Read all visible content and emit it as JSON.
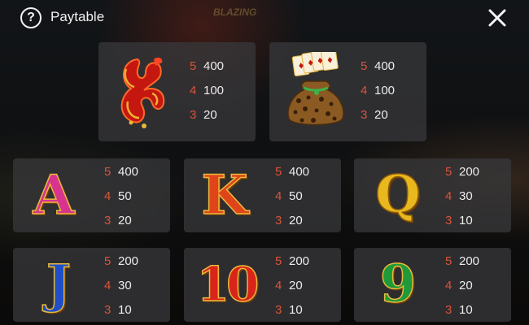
{
  "header": {
    "title": "Paytable",
    "help_icon": "question-circle-icon",
    "close_icon": "close-x-icon",
    "background_logo": "BLAZING"
  },
  "symbols": [
    {
      "name": "red-ribbon-knot",
      "icon": "red-knot-icon",
      "pays": [
        {
          "count": "5",
          "amount": "400"
        },
        {
          "count": "4",
          "amount": "100"
        },
        {
          "count": "3",
          "amount": "20"
        }
      ]
    },
    {
      "name": "money-bag",
      "icon": "money-bag-icon",
      "pays": [
        {
          "count": "5",
          "amount": "400"
        },
        {
          "count": "4",
          "amount": "100"
        },
        {
          "count": "3",
          "amount": "20"
        }
      ]
    },
    {
      "name": "A",
      "glyph": "A",
      "pays": [
        {
          "count": "5",
          "amount": "400"
        },
        {
          "count": "4",
          "amount": "50"
        },
        {
          "count": "3",
          "amount": "20"
        }
      ]
    },
    {
      "name": "K",
      "glyph": "K",
      "pays": [
        {
          "count": "5",
          "amount": "400"
        },
        {
          "count": "4",
          "amount": "50"
        },
        {
          "count": "3",
          "amount": "20"
        }
      ]
    },
    {
      "name": "Q",
      "glyph": "Q",
      "pays": [
        {
          "count": "5",
          "amount": "200"
        },
        {
          "count": "4",
          "amount": "30"
        },
        {
          "count": "3",
          "amount": "10"
        }
      ]
    },
    {
      "name": "J",
      "glyph": "J",
      "pays": [
        {
          "count": "5",
          "amount": "200"
        },
        {
          "count": "4",
          "amount": "30"
        },
        {
          "count": "3",
          "amount": "10"
        }
      ]
    },
    {
      "name": "10",
      "glyph": "10",
      "pays": [
        {
          "count": "5",
          "amount": "200"
        },
        {
          "count": "4",
          "amount": "20"
        },
        {
          "count": "3",
          "amount": "10"
        }
      ]
    },
    {
      "name": "9",
      "glyph": "9",
      "pays": [
        {
          "count": "5",
          "amount": "200"
        },
        {
          "count": "4",
          "amount": "20"
        },
        {
          "count": "3",
          "amount": "10"
        }
      ]
    }
  ],
  "colors": {
    "count": "#d9543a",
    "amount": "#ececec",
    "card": "#37373a",
    "gold_outline": "#e9b93c"
  }
}
